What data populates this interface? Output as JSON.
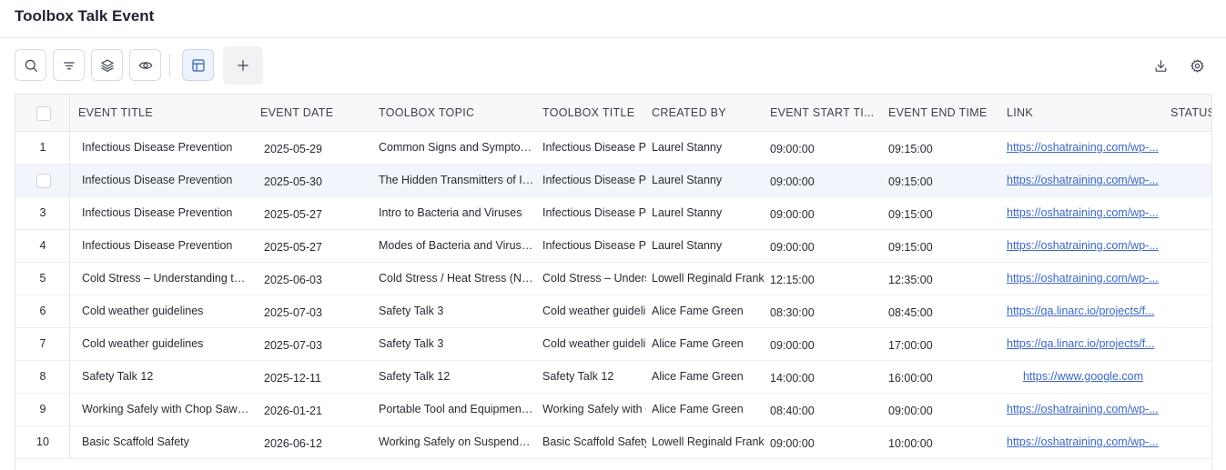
{
  "page": {
    "title": "Toolbox Talk Event"
  },
  "toolbar": {
    "icons": [
      "search-icon",
      "filter-icon",
      "layers-icon",
      "eye-icon",
      "table-view-icon",
      "plus-icon",
      "download-icon",
      "settings-icon"
    ]
  },
  "table": {
    "columns": [
      {
        "label": "EVENT TITLE"
      },
      {
        "label": "EVENT DATE"
      },
      {
        "label": "TOOLBOX TOPIC"
      },
      {
        "label": "TOOLBOX TITLE"
      },
      {
        "label": "CREATED BY"
      },
      {
        "label": "EVENT START TI..."
      },
      {
        "label": "EVENT END TIME"
      },
      {
        "label": "LINK"
      },
      {
        "label": "STATUS"
      }
    ],
    "rows": [
      {
        "num": "1",
        "title": "Infectious Disease Prevention",
        "date": "2025-05-29",
        "topic": "Common Signs and Symptoms of",
        "tbtitle": "Infectious Disease Pre",
        "by": "Laurel Stanny",
        "start": "09:00:00",
        "end": "09:15:00",
        "link": "https://oshatraining.com/wp-...",
        "status": ""
      },
      {
        "num": "",
        "title": "Infectious Disease Prevention",
        "date": "2025-05-30",
        "topic": "The Hidden Transmitters of Infec",
        "tbtitle": "Infectious Disease Pre",
        "by": "Laurel Stanny",
        "start": "09:00:00",
        "end": "09:15:00",
        "link": "https://oshatraining.com/wp-...",
        "status": ""
      },
      {
        "num": "3",
        "title": "Infectious Disease Prevention",
        "date": "2025-05-27",
        "topic": "Intro to Bacteria and Viruses",
        "tbtitle": "Infectious Disease Pre",
        "by": "Laurel Stanny",
        "start": "09:00:00",
        "end": "09:15:00",
        "link": "https://oshatraining.com/wp-...",
        "status": ""
      },
      {
        "num": "4",
        "title": "Infectious Disease Prevention",
        "date": "2025-05-27",
        "topic": "Modes of Bacteria and Virus Tran",
        "tbtitle": "Infectious Disease Pre",
        "by": "Laurel Stanny",
        "start": "09:00:00",
        "end": "09:15:00",
        "link": "https://oshatraining.com/wp-...",
        "status": ""
      },
      {
        "num": "5",
        "title": "Cold Stress – Understanding the E",
        "date": "2025-06-03",
        "topic": "Cold Stress / Heat Stress (New fo",
        "tbtitle": "Cold Stress – Understa",
        "by": "Lowell Reginald Franklin",
        "start": "12:15:00",
        "end": "12:35:00",
        "link": "https://oshatraining.com/wp-...",
        "status": ""
      },
      {
        "num": "6",
        "title": "Cold weather guidelines",
        "date": "2025-07-03",
        "topic": "Safety Talk 3",
        "tbtitle": "Cold weather guidelin",
        "by": "Alice Fame Green",
        "start": "08:30:00",
        "end": "08:45:00",
        "link": "https://qa.linarc.io/projects/f...",
        "status": ""
      },
      {
        "num": "7",
        "title": "Cold weather guidelines",
        "date": "2025-07-03",
        "topic": "Safety Talk 3",
        "tbtitle": "Cold weather guidelin",
        "by": "Alice Fame Green",
        "start": "09:00:00",
        "end": "17:00:00",
        "link": "https://qa.linarc.io/projects/f...",
        "status": ""
      },
      {
        "num": "8",
        "title": "Safety Talk 12",
        "date": "2025-12-11",
        "topic": "Safety Talk 12",
        "tbtitle": "Safety Talk 12",
        "by": "Alice Fame Green",
        "start": "14:00:00",
        "end": "16:00:00",
        "link": "https://www.google.com",
        "status": ""
      },
      {
        "num": "9",
        "title": "Working Safely with Chop Saws ar",
        "date": "2026-01-21",
        "topic": "Portable Tool and Equipment Safe",
        "tbtitle": "Working Safely with C",
        "by": "Alice Fame Green",
        "start": "08:40:00",
        "end": "09:00:00",
        "link": "https://oshatraining.com/wp-...",
        "status": ""
      },
      {
        "num": "10",
        "title": "Basic Scaffold Safety",
        "date": "2026-06-12",
        "topic": "Working Safely on Suspended Sc",
        "tbtitle": "Basic Scaffold Safety",
        "by": "Lowell Reginald Franklin",
        "start": "09:00:00",
        "end": "10:00:00",
        "link": "https://oshatraining.com/wp-...",
        "status": ""
      }
    ]
  }
}
